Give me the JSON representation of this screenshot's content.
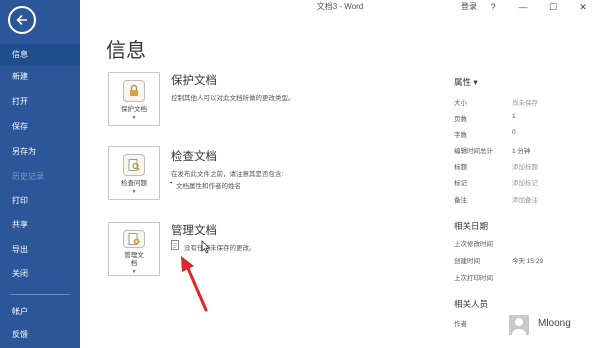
{
  "window": {
    "title": "文档3 - Word",
    "login": "登录",
    "help": "?",
    "minimize": "—",
    "maximize": "☐",
    "close": "✕"
  },
  "sidebar": {
    "back_icon": "back-arrow-icon",
    "items": [
      {
        "label": "信息",
        "active": true
      },
      {
        "label": "新建"
      },
      {
        "label": "打开"
      },
      {
        "label": "保存"
      },
      {
        "label": "另存为"
      },
      {
        "label": "历史记录",
        "disabled": true
      },
      {
        "label": "打印"
      },
      {
        "label": "共享"
      },
      {
        "label": "导出"
      },
      {
        "label": "关闭"
      },
      {
        "label": "帐户"
      },
      {
        "label": "反馈"
      }
    ]
  },
  "main": {
    "title": "信息",
    "protect": {
      "tile_label": "保护文档",
      "heading": "保护文档",
      "desc": "控制其他人可以对此文档所做的更改类型。",
      "icon": "lock-icon"
    },
    "inspect": {
      "tile_label": "检查问题",
      "heading": "检查文档",
      "desc": "在发布此文件之前，请注意其是否包含:",
      "bullet": "文档属性和作者的姓名",
      "icon": "inspect-icon"
    },
    "manage": {
      "tile_label_1": "管理文",
      "tile_label_2": "档",
      "heading": "管理文档",
      "desc": "没有任何未保存的更改。",
      "icon": "manage-document-icon"
    }
  },
  "properties": {
    "heading": "属性 ▾",
    "rows": [
      {
        "label": "大小",
        "value": "尚未保存",
        "muted": true
      },
      {
        "label": "页数",
        "value": "1"
      },
      {
        "label": "字数",
        "value": "0"
      },
      {
        "label": "编辑时间总计",
        "value": "1 分钟"
      },
      {
        "label": "标题",
        "value": "添加标题",
        "muted": true
      },
      {
        "label": "标记",
        "value": "添加标记",
        "muted": true
      },
      {
        "label": "备注",
        "value": "添加备注",
        "muted": true
      }
    ]
  },
  "dates": {
    "heading": "相关日期",
    "rows": [
      {
        "label": "上次修改时间",
        "value": ""
      },
      {
        "label": "创建时间",
        "value": "今天 15:29"
      },
      {
        "label": "上次打印时间",
        "value": ""
      }
    ]
  },
  "people": {
    "heading": "相关人员",
    "author_label": "作者",
    "author_name": "Mloong"
  },
  "colors": {
    "sidebar": "#2b579a",
    "annotation_arrow": "#e0262d"
  }
}
